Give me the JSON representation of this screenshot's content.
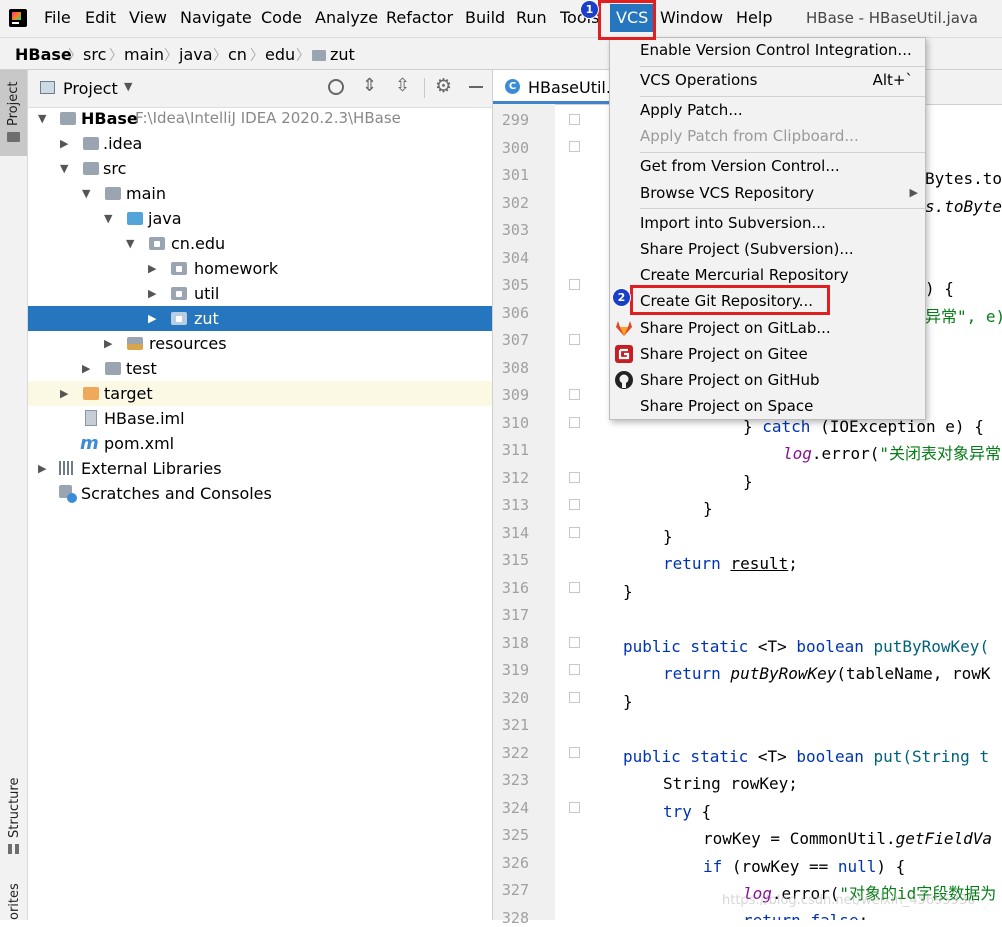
{
  "menubar": {
    "items": [
      "File",
      "Edit",
      "View",
      "Navigate",
      "Code",
      "Analyze",
      "Refactor",
      "Build",
      "Run",
      "Tools",
      "VCS",
      "Window",
      "Help"
    ],
    "window_title": "HBase - HBaseUtil.java"
  },
  "breadcrumb": [
    "HBase",
    "src",
    "main",
    "java",
    "cn",
    "edu",
    "zut"
  ],
  "sidebar_strip": {
    "top_tab": "Project",
    "bottom_tab": "Structure",
    "bottom_tab2": "orites"
  },
  "project_panel": {
    "title": "Project",
    "tree": [
      {
        "label": "HBase",
        "path": "F:\\Idea\\IntelliJ IDEA 2020.2.3\\HBase"
      },
      {
        "label": ".idea"
      },
      {
        "label": "src"
      },
      {
        "label": "main"
      },
      {
        "label": "java"
      },
      {
        "label": "cn.edu"
      },
      {
        "label": "homework"
      },
      {
        "label": "util"
      },
      {
        "label": "zut"
      },
      {
        "label": "resources"
      },
      {
        "label": "test"
      },
      {
        "label": "target"
      },
      {
        "label": "HBase.iml"
      },
      {
        "label": "pom.xml"
      },
      {
        "label": "External Libraries"
      },
      {
        "label": "Scratches and Consoles"
      }
    ]
  },
  "editor": {
    "tab_label": "HBaseUtil.ja",
    "line_numbers": [
      "299",
      "300",
      "301",
      "302",
      "303",
      "304",
      "305",
      "306",
      "307",
      "308",
      "309",
      "310",
      "311",
      "312",
      "313",
      "314",
      "315",
      "316",
      "317",
      "318",
      "319",
      "320",
      "321",
      "322",
      "323",
      "324",
      "325",
      "326",
      "327",
      "328"
    ],
    "code": {
      "l301": "Bytes.to",
      "l302": "s.toByte",
      "l305": ") {",
      "l306": "异常\", e)",
      "l310_a": "} ",
      "l310_b": "catch",
      "l310_c": " (IOException e) {",
      "l311_a": "log",
      "l311_b": ".error(",
      "l311_c": "\"关闭表对象异常",
      "l312": "}",
      "l313": "}",
      "l314": "}",
      "l315_a": "return",
      "l315_b": " ",
      "l315_c": "result",
      "l315_d": ";",
      "l316": "}",
      "l318_a": "public static",
      "l318_b": " <T> ",
      "l318_c": "boolean",
      "l318_d": " putByRowKey(",
      "l319_a": "return",
      "l319_b": " putByRowKey",
      "l319_c": "(tableName, rowK",
      "l320": "}",
      "l322_a": "public static",
      "l322_b": " <T> ",
      "l322_c": "boolean",
      "l322_d": " put(String t",
      "l323": "String rowKey;",
      "l324_a": "try",
      "l324_b": " {",
      "l325_a": "rowKey = CommonUtil.",
      "l325_b": "getFieldVa",
      "l326_a": "if",
      "l326_b": " (rowKey == ",
      "l326_c": "null",
      "l326_d": ") {",
      "l327_a": "log",
      "l327_b": ".error(",
      "l327_c": "\"对象的id字段数据为",
      "l328_a": "return",
      "l328_b": " ",
      "l328_c": "false",
      "l328_d": ";"
    }
  },
  "vcs_menu": {
    "items": [
      {
        "label": "Enable Version Control Integration..."
      },
      {
        "label": "VCS Operations",
        "shortcut": "Alt+`"
      },
      {
        "label": "Apply Patch..."
      },
      {
        "label": "Apply Patch from Clipboard...",
        "disabled": true
      },
      {
        "label": "Get from Version Control..."
      },
      {
        "label": "Browse VCS Repository",
        "submenu": true
      },
      {
        "label": "Import into Subversion..."
      },
      {
        "label": "Share Project (Subversion)..."
      },
      {
        "label": "Create Mercurial Repository"
      },
      {
        "label": "Create Git Repository..."
      },
      {
        "label": "Share Project on GitLab..."
      },
      {
        "label": "Share Project on Gitee"
      },
      {
        "label": "Share Project on GitHub"
      },
      {
        "label": "Share Project on Space"
      }
    ]
  },
  "annotations": {
    "step1": "1",
    "step2": "2"
  },
  "watermark": "https://blog.csdn.net/weixin_45695930",
  "colors": {
    "selection": "#2675bf",
    "highlight_box": "#e02020",
    "badge": "#1a3fc8",
    "keyword": "#0033b3",
    "string": "#067d17",
    "field": "#871094"
  }
}
